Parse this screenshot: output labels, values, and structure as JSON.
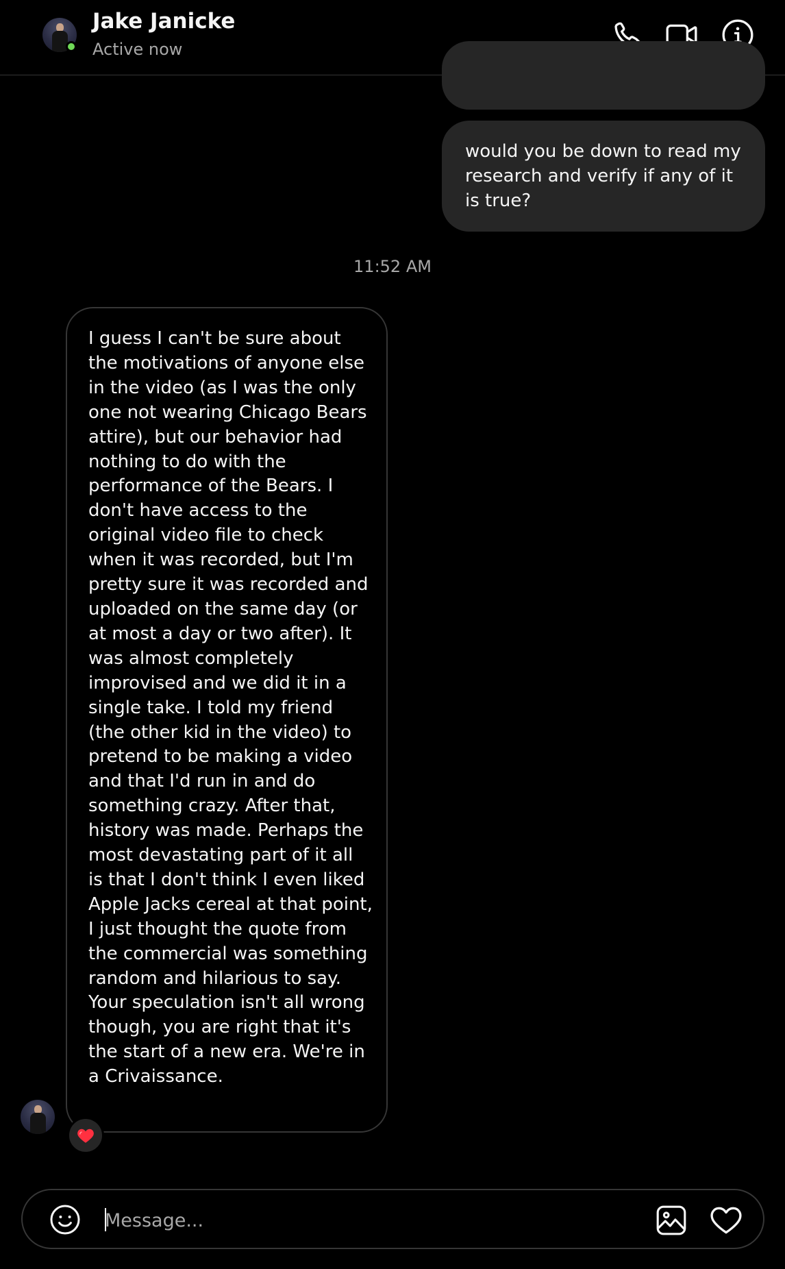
{
  "header": {
    "contact_name": "Jake Janicke",
    "status": "Active now",
    "icons": [
      "phone-icon",
      "video-camera-icon",
      "info-icon"
    ]
  },
  "messages": {
    "outgoing": [
      {
        "text": ""
      },
      {
        "text": "would you be down to read my research and verify if any of it is true?"
      }
    ],
    "timestamp": "11:52 AM",
    "incoming": [
      {
        "text": "I guess I can't be sure about the motivations of anyone else in the video (as I was the only one not wearing Chicago Bears attire), but our behavior had nothing to do with the performance of the Bears. I don't have access to the original video file to check when it was recorded, but I'm pretty sure it was recorded and uploaded on the same day (or at most a day or two after). It was almost completely improvised and we did it in a single take. I told my friend (the other kid in the video) to pretend to be making a video and that I'd run in and do something crazy. After that, history was made. Perhaps the most devastating part of it all is that I don't think I even liked Apple Jacks cereal at that point, I just thought the quote from the commercial was something random and hilarious to say. Your speculation isn't all wrong though, you are right that it's the start of a new era. We're in a Crivaissance.",
        "reaction": "red-heart"
      }
    ]
  },
  "composer": {
    "placeholder": "Message...",
    "value": ""
  },
  "colors": {
    "background": "#000000",
    "bubble_outgoing": "#262626",
    "bubble_incoming_border": "#363636",
    "text_primary": "#f5f5f5",
    "text_secondary": "#a8a8a8",
    "active_green": "#6fd957",
    "heart_red": "#ff3040"
  }
}
